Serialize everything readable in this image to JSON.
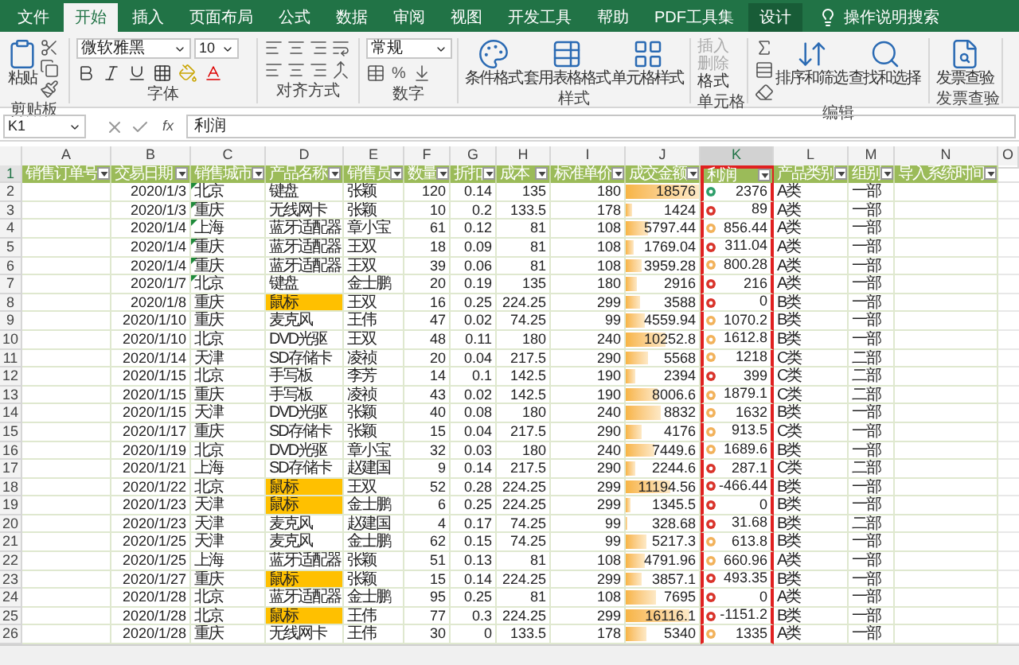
{
  "ribbon_tabs": [
    {
      "label": "文件",
      "selected": false,
      "contextual": false
    },
    {
      "label": "开始",
      "selected": true,
      "contextual": false
    },
    {
      "label": "插入",
      "selected": false,
      "contextual": false
    },
    {
      "label": "页面布局",
      "selected": false,
      "contextual": false
    },
    {
      "label": "公式",
      "selected": false,
      "contextual": false
    },
    {
      "label": "数据",
      "selected": false,
      "contextual": false
    },
    {
      "label": "审阅",
      "selected": false,
      "contextual": false
    },
    {
      "label": "视图",
      "selected": false,
      "contextual": false
    },
    {
      "label": "开发工具",
      "selected": false,
      "contextual": false
    },
    {
      "label": "帮助",
      "selected": false,
      "contextual": false
    },
    {
      "label": "PDF工具集",
      "selected": false,
      "contextual": false
    },
    {
      "label": "设计",
      "selected": false,
      "contextual": true
    }
  ],
  "search": {
    "label": "操作说明搜索"
  },
  "ribbon": {
    "clipboard": {
      "paste": "粘贴",
      "group": "剪贴板"
    },
    "font": {
      "name": "微软雅黑",
      "size": "10",
      "group": "字体"
    },
    "alignment": {
      "group": "对齐方式"
    },
    "number": {
      "format": "常规",
      "percent": "%",
      "group": "数字"
    },
    "styles": {
      "buttons": [
        "条件格式",
        "套用表格格式",
        "单元格样式"
      ],
      "group": "样式"
    },
    "cells": {
      "buttons": [
        "插入",
        "删除",
        "格式"
      ],
      "group": "单元格"
    },
    "editing": {
      "buttons": [
        "排序和筛选",
        "查找和选择"
      ],
      "group": "编辑"
    },
    "invoice": {
      "button": "发票查验",
      "group": "发票查验"
    }
  },
  "formula_bar": {
    "name_box": "K1",
    "function_label": "fx",
    "formula": "利润"
  },
  "columns": [
    {
      "letter": "A",
      "header": "销售订单号",
      "selected": false
    },
    {
      "letter": "B",
      "header": "交易日期",
      "selected": false
    },
    {
      "letter": "C",
      "header": "销售城市",
      "selected": false
    },
    {
      "letter": "D",
      "header": "产品名称",
      "selected": false
    },
    {
      "letter": "E",
      "header": "销售员",
      "selected": false
    },
    {
      "letter": "F",
      "header": "数量",
      "selected": false
    },
    {
      "letter": "G",
      "header": "折扣",
      "selected": false
    },
    {
      "letter": "H",
      "header": "成本",
      "selected": false
    },
    {
      "letter": "I",
      "header": "标准单价",
      "selected": false
    },
    {
      "letter": "J",
      "header": "成交金额",
      "selected": false
    },
    {
      "letter": "K",
      "header": "利润",
      "selected": true
    },
    {
      "letter": "L",
      "header": "产品类别",
      "selected": false
    },
    {
      "letter": "M",
      "header": "组别",
      "selected": false
    },
    {
      "letter": "N",
      "header": "导入系统时间",
      "selected": false
    },
    {
      "letter": "O",
      "selected": false
    }
  ],
  "header_row_number": "1",
  "rows": [
    {
      "n": "2",
      "date": "2020/1/3",
      "city": "北京",
      "flag": true,
      "product": "键盘",
      "highlight": false,
      "seller": "张颖",
      "qty": "120",
      "discount": "0.14",
      "cost": "135",
      "price": "180",
      "amount": "18576",
      "level": 1.0,
      "profit": "2376",
      "color": "#2e9e6a",
      "category": "A类",
      "dept": "一部"
    },
    {
      "n": "3",
      "date": "2020/1/3",
      "city": "重庆",
      "flag": true,
      "product": "无线网卡",
      "highlight": false,
      "seller": "张颖",
      "qty": "10",
      "discount": "0.2",
      "cost": "133.5",
      "price": "178",
      "amount": "1424",
      "level": 0.08,
      "profit": "89",
      "color": "#d9342b",
      "category": "A类",
      "dept": "一部"
    },
    {
      "n": "4",
      "date": "2020/1/4",
      "city": "上海",
      "flag": true,
      "product": "蓝牙适配器",
      "highlight": false,
      "seller": "章小宝",
      "qty": "61",
      "discount": "0.12",
      "cost": "81",
      "price": "108",
      "amount": "5797.44",
      "level": 0.31,
      "profit": "856.44",
      "color": "#f2b25b",
      "category": "A类",
      "dept": "一部"
    },
    {
      "n": "5",
      "date": "2020/1/4",
      "city": "重庆",
      "flag": true,
      "product": "蓝牙适配器",
      "highlight": false,
      "seller": "王双",
      "qty": "18",
      "discount": "0.09",
      "cost": "81",
      "price": "108",
      "amount": "1769.04",
      "level": 0.1,
      "profit": "311.04",
      "color": "#d9342b",
      "category": "A类",
      "dept": "一部"
    },
    {
      "n": "6",
      "date": "2020/1/4",
      "city": "重庆",
      "flag": true,
      "product": "蓝牙适配器",
      "highlight": false,
      "seller": "王双",
      "qty": "39",
      "discount": "0.06",
      "cost": "81",
      "price": "108",
      "amount": "3959.28",
      "level": 0.21,
      "profit": "800.28",
      "color": "#f2b25b",
      "category": "A类",
      "dept": "一部"
    },
    {
      "n": "7",
      "date": "2020/1/7",
      "city": "北京",
      "flag": true,
      "product": "键盘",
      "highlight": false,
      "seller": "金士鹏",
      "qty": "20",
      "discount": "0.19",
      "cost": "135",
      "price": "180",
      "amount": "2916",
      "level": 0.16,
      "profit": "216",
      "color": "#d9342b",
      "category": "A类",
      "dept": "一部"
    },
    {
      "n": "8",
      "date": "2020/1/8",
      "city": "重庆",
      "flag": false,
      "product": "鼠标",
      "highlight": true,
      "seller": "王双",
      "qty": "16",
      "discount": "0.25",
      "cost": "224.25",
      "price": "299",
      "amount": "3588",
      "level": 0.19,
      "profit": "0",
      "color": "#d9342b",
      "category": "B类",
      "dept": "一部"
    },
    {
      "n": "9",
      "date": "2020/1/10",
      "city": "重庆",
      "flag": false,
      "product": "麦克风",
      "highlight": false,
      "seller": "王伟",
      "qty": "47",
      "discount": "0.02",
      "cost": "74.25",
      "price": "99",
      "amount": "4559.94",
      "level": 0.25,
      "profit": "1070.2",
      "color": "#f2b25b",
      "category": "B类",
      "dept": "一部"
    },
    {
      "n": "10",
      "date": "2020/1/10",
      "city": "北京",
      "flag": false,
      "product": "DVD光驱",
      "highlight": false,
      "seller": "王双",
      "qty": "48",
      "discount": "0.11",
      "cost": "180",
      "price": "240",
      "amount": "10252.8",
      "level": 0.55,
      "profit": "1612.8",
      "color": "#f2b25b",
      "category": "B类",
      "dept": "一部"
    },
    {
      "n": "11",
      "date": "2020/1/14",
      "city": "天津",
      "flag": false,
      "product": "SD存储卡",
      "highlight": false,
      "seller": "凌祯",
      "qty": "20",
      "discount": "0.04",
      "cost": "217.5",
      "price": "290",
      "amount": "5568",
      "level": 0.3,
      "profit": "1218",
      "color": "#f2b25b",
      "category": "C类",
      "dept": "二部"
    },
    {
      "n": "12",
      "date": "2020/1/15",
      "city": "北京",
      "flag": false,
      "product": "手写板",
      "highlight": false,
      "seller": "李芳",
      "qty": "14",
      "discount": "0.1",
      "cost": "142.5",
      "price": "190",
      "amount": "2394",
      "level": 0.13,
      "profit": "399",
      "color": "#d9342b",
      "category": "C类",
      "dept": "二部"
    },
    {
      "n": "13",
      "date": "2020/1/15",
      "city": "重庆",
      "flag": false,
      "product": "手写板",
      "highlight": false,
      "seller": "凌祯",
      "qty": "43",
      "discount": "0.02",
      "cost": "142.5",
      "price": "190",
      "amount": "8006.6",
      "level": 0.43,
      "profit": "1879.1",
      "color": "#f2b25b",
      "category": "C类",
      "dept": "二部"
    },
    {
      "n": "14",
      "date": "2020/1/15",
      "city": "天津",
      "flag": false,
      "product": "DVD光驱",
      "highlight": false,
      "seller": "张颖",
      "qty": "40",
      "discount": "0.08",
      "cost": "180",
      "price": "240",
      "amount": "8832",
      "level": 0.48,
      "profit": "1632",
      "color": "#f2b25b",
      "category": "B类",
      "dept": "一部"
    },
    {
      "n": "15",
      "date": "2020/1/17",
      "city": "重庆",
      "flag": false,
      "product": "SD存储卡",
      "highlight": false,
      "seller": "张颖",
      "qty": "15",
      "discount": "0.04",
      "cost": "217.5",
      "price": "290",
      "amount": "4176",
      "level": 0.22,
      "profit": "913.5",
      "color": "#f2b25b",
      "category": "C类",
      "dept": "一部"
    },
    {
      "n": "16",
      "date": "2020/1/19",
      "city": "北京",
      "flag": false,
      "product": "DVD光驱",
      "highlight": false,
      "seller": "章小宝",
      "qty": "32",
      "discount": "0.03",
      "cost": "180",
      "price": "240",
      "amount": "7449.6",
      "level": 0.4,
      "profit": "1689.6",
      "color": "#f2b25b",
      "category": "B类",
      "dept": "一部"
    },
    {
      "n": "17",
      "date": "2020/1/21",
      "city": "上海",
      "flag": false,
      "product": "SD存储卡",
      "highlight": false,
      "seller": "赵建国",
      "qty": "9",
      "discount": "0.14",
      "cost": "217.5",
      "price": "290",
      "amount": "2244.6",
      "level": 0.12,
      "profit": "287.1",
      "color": "#d9342b",
      "category": "C类",
      "dept": "二部"
    },
    {
      "n": "18",
      "date": "2020/1/22",
      "city": "北京",
      "flag": false,
      "product": "鼠标",
      "highlight": true,
      "seller": "王双",
      "qty": "52",
      "discount": "0.28",
      "cost": "224.25",
      "price": "299",
      "amount": "11194.56",
      "level": 0.6,
      "profit": "-466.44",
      "color": "#d9342b",
      "category": "B类",
      "dept": "一部"
    },
    {
      "n": "19",
      "date": "2020/1/23",
      "city": "天津",
      "flag": false,
      "product": "鼠标",
      "highlight": true,
      "seller": "金士鹏",
      "qty": "6",
      "discount": "0.25",
      "cost": "224.25",
      "price": "299",
      "amount": "1345.5",
      "level": 0.07,
      "profit": "0",
      "color": "#d9342b",
      "category": "B类",
      "dept": "一部"
    },
    {
      "n": "20",
      "date": "2020/1/23",
      "city": "天津",
      "flag": false,
      "product": "麦克风",
      "highlight": false,
      "seller": "赵建国",
      "qty": "4",
      "discount": "0.17",
      "cost": "74.25",
      "price": "99",
      "amount": "328.68",
      "level": 0.02,
      "profit": "31.68",
      "color": "#d9342b",
      "category": "B类",
      "dept": "二部"
    },
    {
      "n": "21",
      "date": "2020/1/25",
      "city": "天津",
      "flag": false,
      "product": "麦克风",
      "highlight": false,
      "seller": "金士鹏",
      "qty": "62",
      "discount": "0.15",
      "cost": "74.25",
      "price": "99",
      "amount": "5217.3",
      "level": 0.28,
      "profit": "613.8",
      "color": "#f2b25b",
      "category": "B类",
      "dept": "一部"
    },
    {
      "n": "22",
      "date": "2020/1/25",
      "city": "上海",
      "flag": false,
      "product": "蓝牙适配器",
      "highlight": false,
      "seller": "张颖",
      "qty": "51",
      "discount": "0.13",
      "cost": "81",
      "price": "108",
      "amount": "4791.96",
      "level": 0.26,
      "profit": "660.96",
      "color": "#f2b25b",
      "category": "A类",
      "dept": "一部"
    },
    {
      "n": "23",
      "date": "2020/1/27",
      "city": "重庆",
      "flag": false,
      "product": "鼠标",
      "highlight": true,
      "seller": "张颖",
      "qty": "15",
      "discount": "0.14",
      "cost": "224.25",
      "price": "299",
      "amount": "3857.1",
      "level": 0.21,
      "profit": "493.35",
      "color": "#d9342b",
      "category": "B类",
      "dept": "一部"
    },
    {
      "n": "24",
      "date": "2020/1/28",
      "city": "北京",
      "flag": false,
      "product": "蓝牙适配器",
      "highlight": false,
      "seller": "金士鹏",
      "qty": "95",
      "discount": "0.25",
      "cost": "81",
      "price": "108",
      "amount": "7695",
      "level": 0.41,
      "profit": "0",
      "color": "#d9342b",
      "category": "A类",
      "dept": "一部"
    },
    {
      "n": "25",
      "date": "2020/1/28",
      "city": "北京",
      "flag": false,
      "product": "鼠标",
      "highlight": true,
      "seller": "王伟",
      "qty": "77",
      "discount": "0.3",
      "cost": "224.25",
      "price": "299",
      "amount": "16116.1",
      "level": 0.87,
      "profit": "-1151.2",
      "color": "#d9342b",
      "category": "B类",
      "dept": "一部"
    },
    {
      "n": "26",
      "date": "2020/1/28",
      "city": "重庆",
      "flag": false,
      "product": "无线网卡",
      "highlight": false,
      "seller": "王伟",
      "qty": "30",
      "discount": "0",
      "cost": "133.5",
      "price": "178",
      "amount": "5340",
      "level": 0.29,
      "profit": "1335",
      "color": "#f2b25b",
      "category": "A类",
      "dept": "一部"
    }
  ]
}
